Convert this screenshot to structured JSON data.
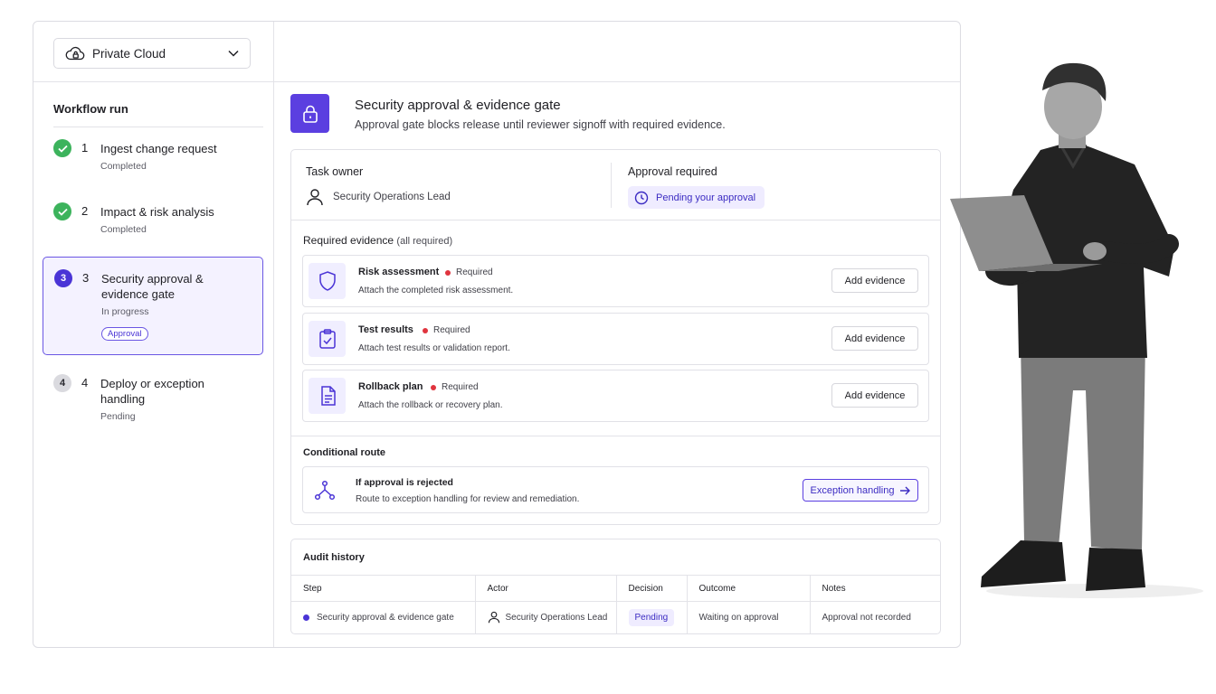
{
  "sidebar": {
    "environment": {
      "label": "Private Cloud",
      "icon": "cloud-lock-icon"
    },
    "title": "Workflow run",
    "steps": [
      {
        "num": "1",
        "title": "Ingest change request",
        "status": "Completed",
        "state": "done"
      },
      {
        "num": "2",
        "title": "Impact & risk analysis",
        "status": "Completed",
        "state": "done"
      },
      {
        "num": "3",
        "title": "Security approval & evidence gate",
        "status": "In progress",
        "state": "active",
        "tag": "Approval"
      },
      {
        "num": "4",
        "title": "Deploy or exception handling",
        "status": "Pending",
        "state": "pending"
      }
    ]
  },
  "gate": {
    "title": "Security approval & evidence gate",
    "subtitle": "Approval gate blocks release until reviewer signoff with required evidence."
  },
  "owner": {
    "label": "Task owner",
    "value": "Security Operations Lead"
  },
  "approval": {
    "label": "Approval required",
    "status": "Pending your approval"
  },
  "evidence": {
    "heading": "Required evidence",
    "heading_note": "(all required)",
    "items": [
      {
        "name": "Risk assessment",
        "req": "Required",
        "desc": "Attach the completed risk assessment.",
        "button": "Add evidence",
        "icon": "shield-icon"
      },
      {
        "name": "Test results",
        "req": "Required",
        "desc": "Attach test results or validation report.",
        "button": "Add evidence",
        "icon": "clipboard-check-icon"
      },
      {
        "name": "Rollback plan",
        "req": "Required",
        "desc": "Attach the rollback or recovery plan.",
        "button": "Add evidence",
        "icon": "document-icon"
      }
    ]
  },
  "conditional": {
    "heading": "Conditional route",
    "title": "If approval is rejected",
    "desc": "Route to exception handling for review and remediation.",
    "button": "Exception handling"
  },
  "audit": {
    "title": "Audit history",
    "columns": [
      "Step",
      "Actor",
      "Decision",
      "Outcome",
      "Notes"
    ],
    "rows": [
      {
        "step": "Security approval & evidence gate",
        "actor": "Security Operations Lead",
        "decision": "Pending",
        "outcome": "Waiting on approval",
        "notes": "Approval not recorded"
      }
    ]
  },
  "colors": {
    "accent": "#5b3fe0",
    "success": "#3cb35c",
    "required": "#e0343e"
  }
}
